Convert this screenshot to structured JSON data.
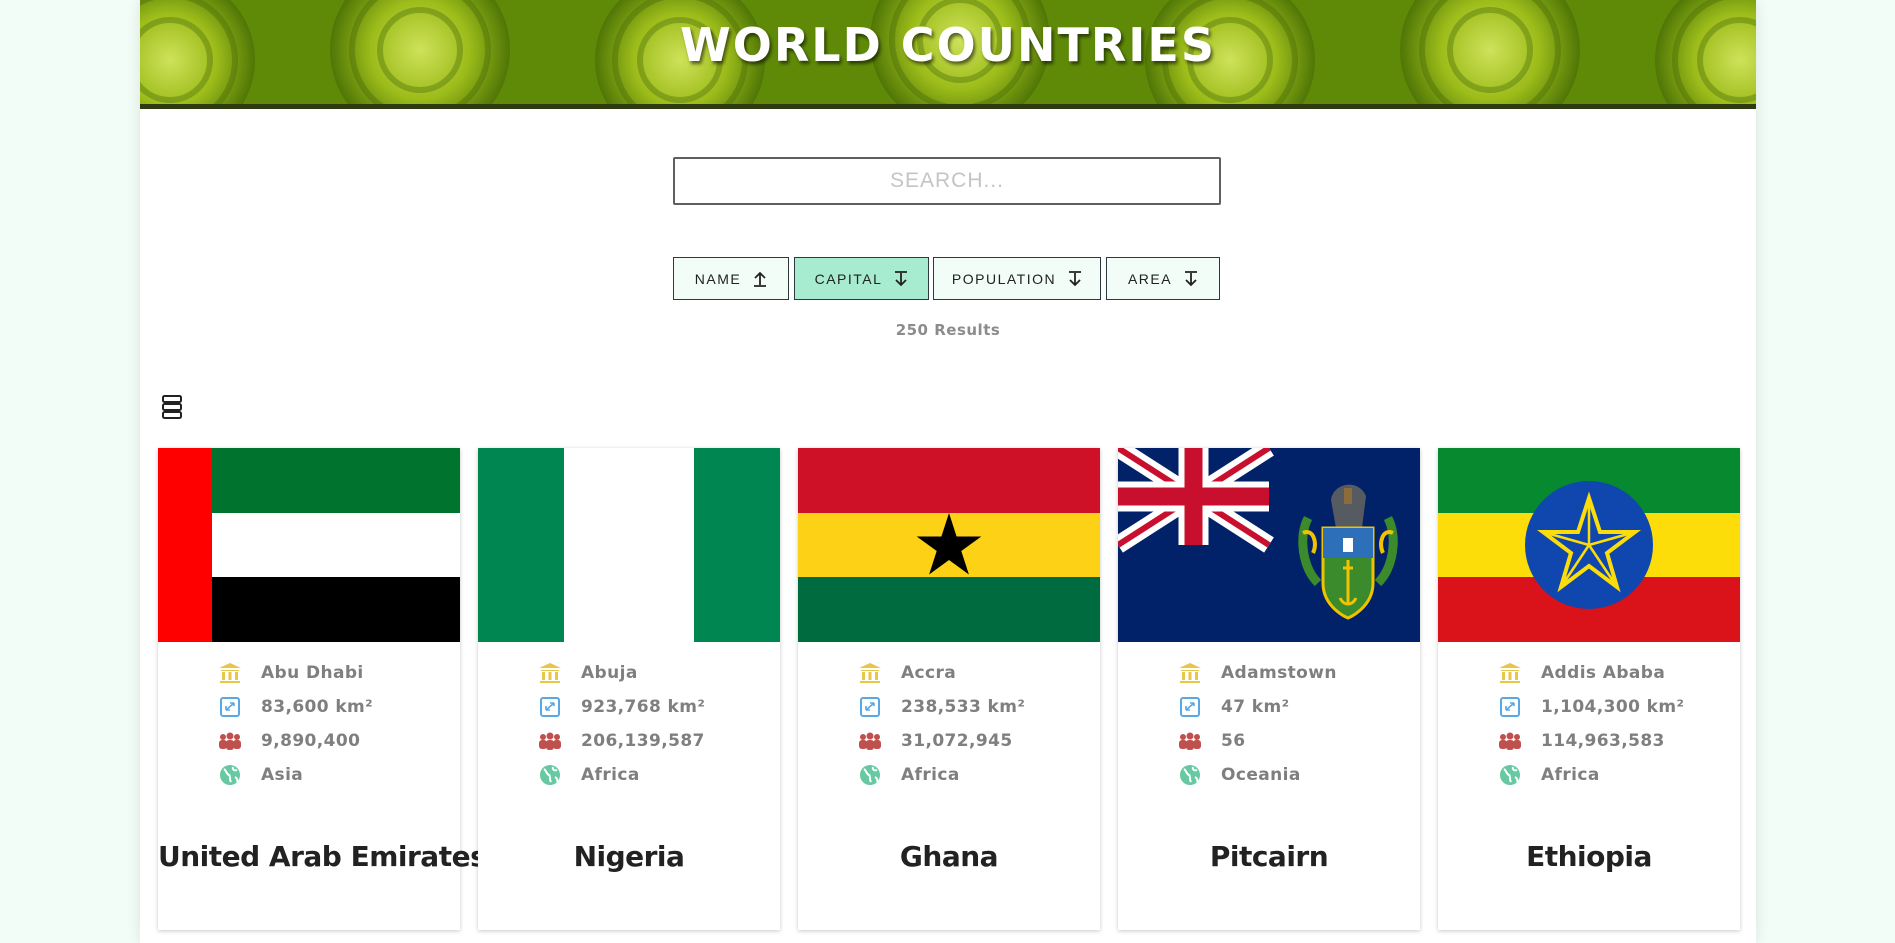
{
  "header": {
    "title": "WORLD COUNTRIES"
  },
  "search": {
    "placeholder": "SEARCH..."
  },
  "sort": {
    "buttons": [
      {
        "label": "NAME",
        "direction": "up",
        "active": false
      },
      {
        "label": "CAPITAL",
        "direction": "down",
        "active": true
      },
      {
        "label": "POPULATION",
        "direction": "down",
        "active": false
      },
      {
        "label": "AREA",
        "direction": "down",
        "active": false
      }
    ]
  },
  "results": {
    "text": "250 Results"
  },
  "view_toggle": {
    "icon": "list-view-icon"
  },
  "colors": {
    "background": "#f1fdf6",
    "active_sort": "#a7ecd0",
    "capital_icon": "#e8c64a",
    "area_icon": "#5aa7e8",
    "population_icon": "#c0504d",
    "region_icon": "#66c9a2"
  },
  "countries": [
    {
      "name": "United Arab Emirates",
      "capital": "Abu Dhabi",
      "area": "83,600 km²",
      "population": "9,890,400",
      "region": "Asia",
      "flag": "uae"
    },
    {
      "name": "Nigeria",
      "capital": "Abuja",
      "area": "923,768 km²",
      "population": "206,139,587",
      "region": "Africa",
      "flag": "nigeria"
    },
    {
      "name": "Ghana",
      "capital": "Accra",
      "area": "238,533 km²",
      "population": "31,072,945",
      "region": "Africa",
      "flag": "ghana"
    },
    {
      "name": "Pitcairn",
      "capital": "Adamstown",
      "area": "47 km²",
      "population": "56",
      "region": "Oceania",
      "flag": "pitcairn"
    },
    {
      "name": "Ethiopia",
      "capital": "Addis Ababa",
      "area": "1,104,300 km²",
      "population": "114,963,583",
      "region": "Africa",
      "flag": "ethiopia"
    }
  ]
}
